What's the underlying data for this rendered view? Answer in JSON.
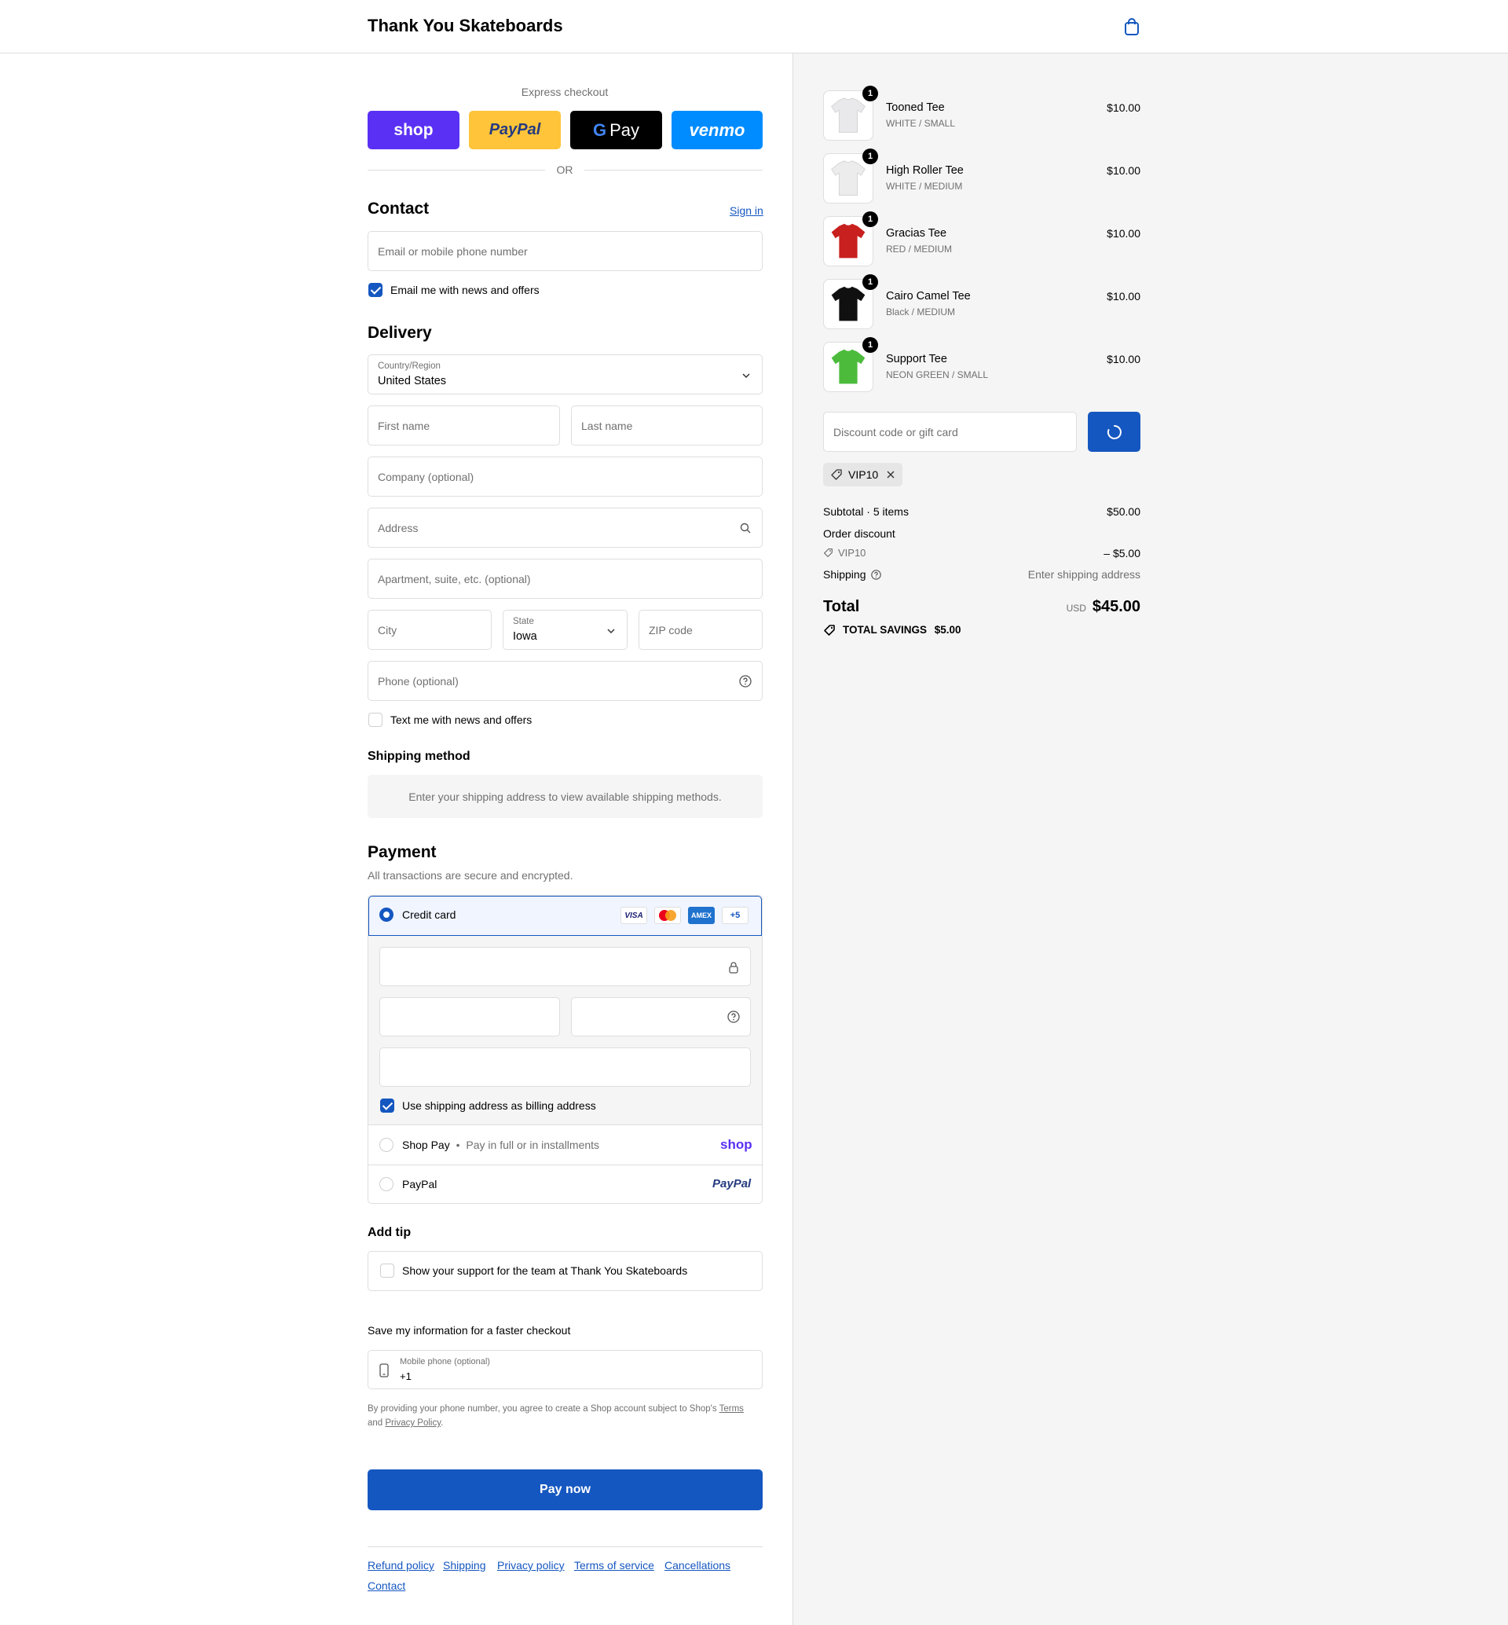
{
  "header": {
    "brand": "Thank You Skateboards",
    "cart_icon": "shopping-bag-icon"
  },
  "express": {
    "title": "Express checkout",
    "buttons": [
      "shop",
      "PayPal",
      "Pay",
      "venmo"
    ],
    "or": "OR"
  },
  "contact": {
    "title": "Contact",
    "signin": "Sign in",
    "email_placeholder": "Email or mobile phone number",
    "news_label": "Email me with news and offers",
    "news_checked": true
  },
  "delivery": {
    "title": "Delivery",
    "country_label": "Country/Region",
    "country_value": "United States",
    "first_name": "First name",
    "last_name": "Last name",
    "company": "Company (optional)",
    "address": "Address",
    "apartment": "Apartment, suite, etc. (optional)",
    "city": "City",
    "state_label": "State",
    "state_value": "Iowa",
    "zip": "ZIP code",
    "phone": "Phone (optional)",
    "text_label": "Text me with news and offers"
  },
  "shipping_method": {
    "title": "Shipping method",
    "notice": "Enter your shipping address to view available shipping methods."
  },
  "payment": {
    "title": "Payment",
    "subtitle": "All transactions are secure and encrypted.",
    "credit_card": "Credit card",
    "card_logos": [
      "VISA",
      "AMEX",
      "+5"
    ],
    "billing_label": "Use shipping address as billing address",
    "shop_pay": "Shop Pay",
    "shop_pay_desc": "Pay in full or in installments",
    "shop_logo": "shop",
    "paypal": "PayPal",
    "paypal_logo": "PayPal"
  },
  "tip": {
    "title": "Add tip",
    "label": "Show your support for the team at Thank You Skateboards"
  },
  "save_info": {
    "title": "Save my information for a faster checkout",
    "phone_label": "Mobile phone (optional)",
    "phone_value": "+1",
    "legal_1": "By providing your phone number, you agree to create a Shop account subject to Shop's",
    "terms": "Terms",
    "legal_and": "and",
    "privacy": "Privacy Policy",
    "legal_end": "."
  },
  "pay_now": "Pay now",
  "footer": [
    "Refund policy",
    "Shipping",
    "Privacy policy",
    "Terms of service",
    "Cancellations",
    "Contact"
  ],
  "cart": {
    "items": [
      {
        "name": "Tooned Tee",
        "variant": "WHITE / SMALL",
        "price": "$10.00",
        "qty": "1",
        "color": "#e9e9ec"
      },
      {
        "name": "High Roller Tee",
        "variant": "WHITE / MEDIUM",
        "price": "$10.00",
        "qty": "1",
        "color": "#ececec"
      },
      {
        "name": "Gracias Tee",
        "variant": "RED / MEDIUM",
        "price": "$10.00",
        "qty": "1",
        "color": "#c8201e"
      },
      {
        "name": "Cairo Camel Tee",
        "variant": "Black / MEDIUM",
        "price": "$10.00",
        "qty": "1",
        "color": "#101010"
      },
      {
        "name": "Support Tee",
        "variant": "NEON GREEN / SMALL",
        "price": "$10.00",
        "qty": "1",
        "color": "#4cbb3c"
      }
    ],
    "discount_placeholder": "Discount code or gift card",
    "code": "VIP10",
    "subtotal_label": "Subtotal · 5 items",
    "subtotal_value": "$50.00",
    "order_discount": "Order discount",
    "discount_code": "VIP10",
    "discount_value": "– $5.00",
    "shipping_label": "Shipping",
    "shipping_value": "Enter shipping address",
    "total_label": "Total",
    "currency": "USD",
    "total_value": "$45.00",
    "savings_label": "TOTAL SAVINGS",
    "savings_value": "$5.00"
  },
  "colors": {
    "accent": "#1557c0",
    "shop": "#5a31f4",
    "paypal_yellow": "#ffc439",
    "venmo": "#008cff"
  }
}
